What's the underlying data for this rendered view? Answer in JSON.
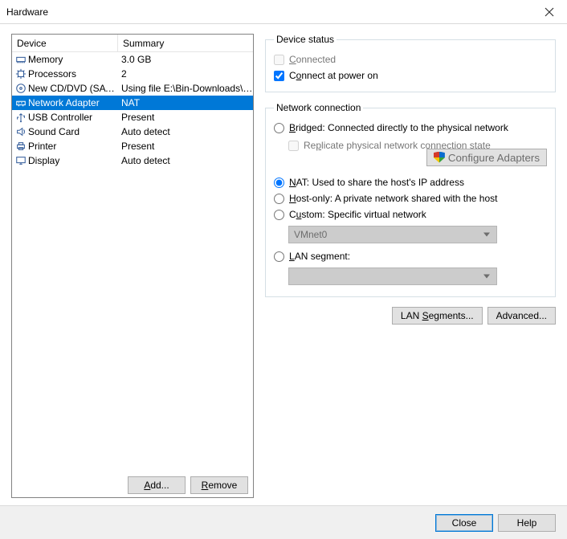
{
  "window": {
    "title": "Hardware"
  },
  "columns": {
    "device": "Device",
    "summary": "Summary"
  },
  "hardware": [
    {
      "id": "memory",
      "device": "Memory",
      "summary": "3.0 GB"
    },
    {
      "id": "cpu",
      "device": "Processors",
      "summary": "2"
    },
    {
      "id": "cd",
      "device": "New CD/DVD (SATA)",
      "summary": "Using file E:\\Bin-Downloads\\i..."
    },
    {
      "id": "net",
      "device": "Network Adapter",
      "summary": "NAT",
      "selected": true
    },
    {
      "id": "usb",
      "device": "USB Controller",
      "summary": "Present"
    },
    {
      "id": "sound",
      "device": "Sound Card",
      "summary": "Auto detect"
    },
    {
      "id": "printer",
      "device": "Printer",
      "summary": "Present"
    },
    {
      "id": "display",
      "device": "Display",
      "summary": "Auto detect"
    }
  ],
  "hw_buttons": {
    "add": "Add...",
    "remove": "Remove"
  },
  "device_status": {
    "legend": "Device status",
    "connected_label": "Connected",
    "connected_checked": false,
    "connected_disabled": true,
    "poweron_label": "Connect at power on",
    "poweron_checked": true,
    "poweron_disabled": false
  },
  "netconn": {
    "legend": "Network connection",
    "bridged_label": "Bridged: Connected directly to the physical network",
    "replicate_label": "Replicate physical network connection state",
    "nat_label": "NAT: Used to share the host's IP address",
    "hostonly_label": "Host-only: A private network shared with the host",
    "custom_label": "Custom: Specific virtual network",
    "custom_value": "VMnet0",
    "lanseg_label": "LAN segment:",
    "lanseg_value": "",
    "selected": "nat",
    "configure_adapters": "Configure Adapters",
    "lan_segments_btn": "LAN Segments...",
    "advanced_btn": "Advanced..."
  },
  "footer": {
    "close": "Close",
    "help": "Help"
  },
  "underline": {
    "connected": "C",
    "poweron": "o",
    "bridged": "B",
    "replicate": "p",
    "nat": "N",
    "hostonly": "H",
    "custom": "u",
    "lanseg": "L",
    "add": "A",
    "remove": "R",
    "lanseg_btn": "S"
  }
}
